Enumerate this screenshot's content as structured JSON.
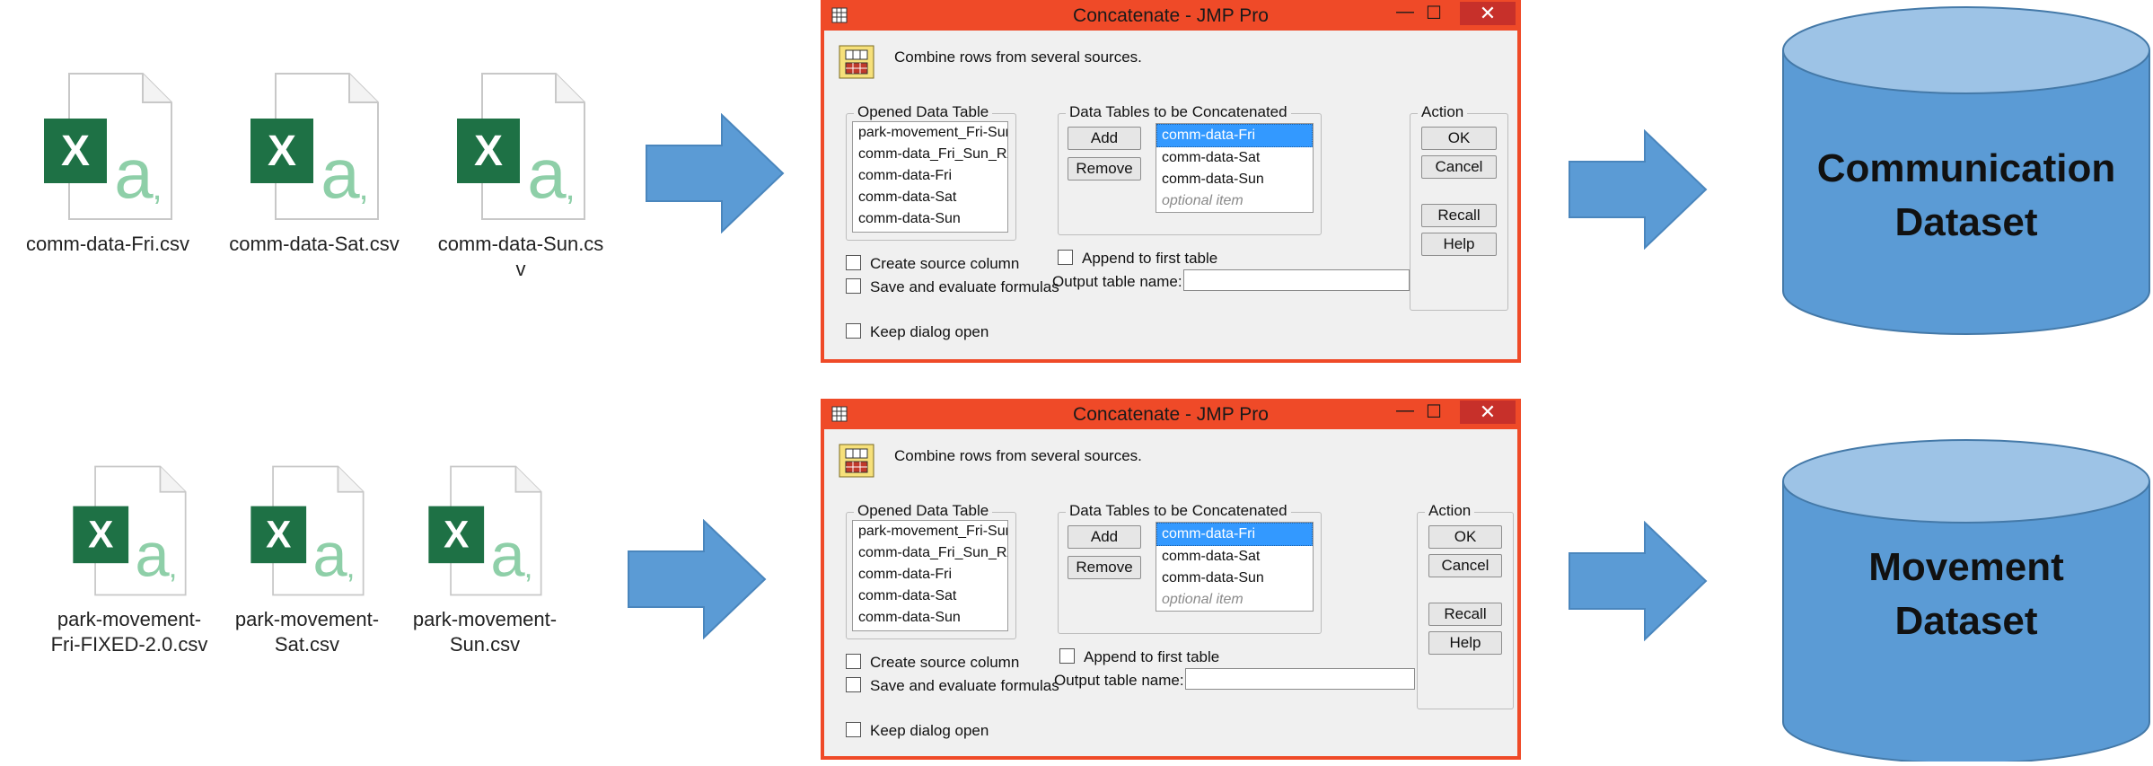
{
  "top": {
    "files": [
      "comm-data-Fri.csv",
      "comm-data-Sat.csv",
      "comm-data-Sun.csv"
    ],
    "dialog": {
      "title": "Concatenate - JMP Pro",
      "controls": {
        "minimize": "—",
        "maximize": "☐",
        "close": "✕"
      },
      "description": "Combine rows from several sources.",
      "opened_label": "Opened Data Table",
      "opened_items": [
        "park-movement_Fri-Sun",
        "comm-data_Fri_Sun_RAW",
        "comm-data-Fri",
        "comm-data-Sat",
        "comm-data-Sun"
      ],
      "concat_label": "Data Tables to be Concatenated",
      "concat_items": [
        "comm-data-Fri",
        "comm-data-Sat",
        "comm-data-Sun"
      ],
      "concat_placeholder": "optional item",
      "add_label": "Add",
      "remove_label": "Remove",
      "action_label": "Action",
      "ok_label": "OK",
      "cancel_label": "Cancel",
      "recall_label": "Recall",
      "help_label": "Help",
      "create_source_label": "Create source column",
      "save_formulas_label": "Save and evaluate formulas",
      "append_label": "Append to first table",
      "output_label": "Output table name:",
      "output_value": "",
      "keep_open_label": "Keep dialog open"
    },
    "dataset": {
      "line1": "Communication",
      "line2": "Dataset"
    }
  },
  "bottom": {
    "files": [
      "park-movement-Fri-FIXED-2.0.csv",
      "park-movement-Sat.csv",
      "park-movement-Sun.csv"
    ],
    "dialog": {
      "title": "Concatenate - JMP Pro",
      "controls": {
        "minimize": "—",
        "maximize": "☐",
        "close": "✕"
      },
      "description": "Combine rows from several sources.",
      "opened_label": "Opened Data Table",
      "opened_items": [
        "park-movement_Fri-Sun",
        "comm-data_Fri_Sun_RAW",
        "comm-data-Fri",
        "comm-data-Sat",
        "comm-data-Sun"
      ],
      "concat_label": "Data Tables to be Concatenated",
      "concat_items": [
        "comm-data-Fri",
        "comm-data-Sat",
        "comm-data-Sun"
      ],
      "concat_placeholder": "optional item",
      "add_label": "Add",
      "remove_label": "Remove",
      "action_label": "Action",
      "ok_label": "OK",
      "cancel_label": "Cancel",
      "recall_label": "Recall",
      "help_label": "Help",
      "create_source_label": "Create source column",
      "save_formulas_label": "Save and evaluate formulas",
      "append_label": "Append to first table",
      "output_label": "Output table name:",
      "output_value": "",
      "keep_open_label": "Keep dialog open"
    },
    "dataset": {
      "line1": "Movement",
      "line2": "Dataset"
    }
  },
  "colors": {
    "arrow": "#5b9bd5",
    "cylinder_body": "#5b9bd5",
    "cylinder_top": "#9dc3e6",
    "dialog_border": "#ef4a28",
    "excel_green": "#1e7145",
    "excel_light": "#8ecfa8"
  },
  "icons": {
    "file": "excel-csv-icon",
    "combine": "concatenate-table-icon",
    "app": "jmp-app-icon"
  }
}
